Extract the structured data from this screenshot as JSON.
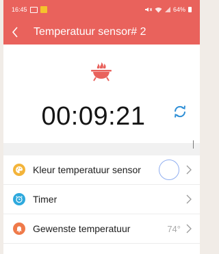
{
  "status": {
    "time": "16:45",
    "battery": "64%"
  },
  "header": {
    "title": "Temperatuur sensor# 2"
  },
  "timer": {
    "value": "00:09:21"
  },
  "settings": [
    {
      "label": "Kleur temperatuur sensor",
      "icon": "palette-icon",
      "color": "#f3b43a"
    },
    {
      "label": "Timer",
      "icon": "alarm-clock-icon",
      "color": "#2ea9dd"
    },
    {
      "label": "Gewenste temperatuur",
      "value": "74°",
      "icon": "bell-icon",
      "color": "#ef7a4a"
    }
  ],
  "colors": {
    "accent": "#e9625c",
    "refresh": "#2f8fd6",
    "selected_color_ring": "#90aef0"
  }
}
